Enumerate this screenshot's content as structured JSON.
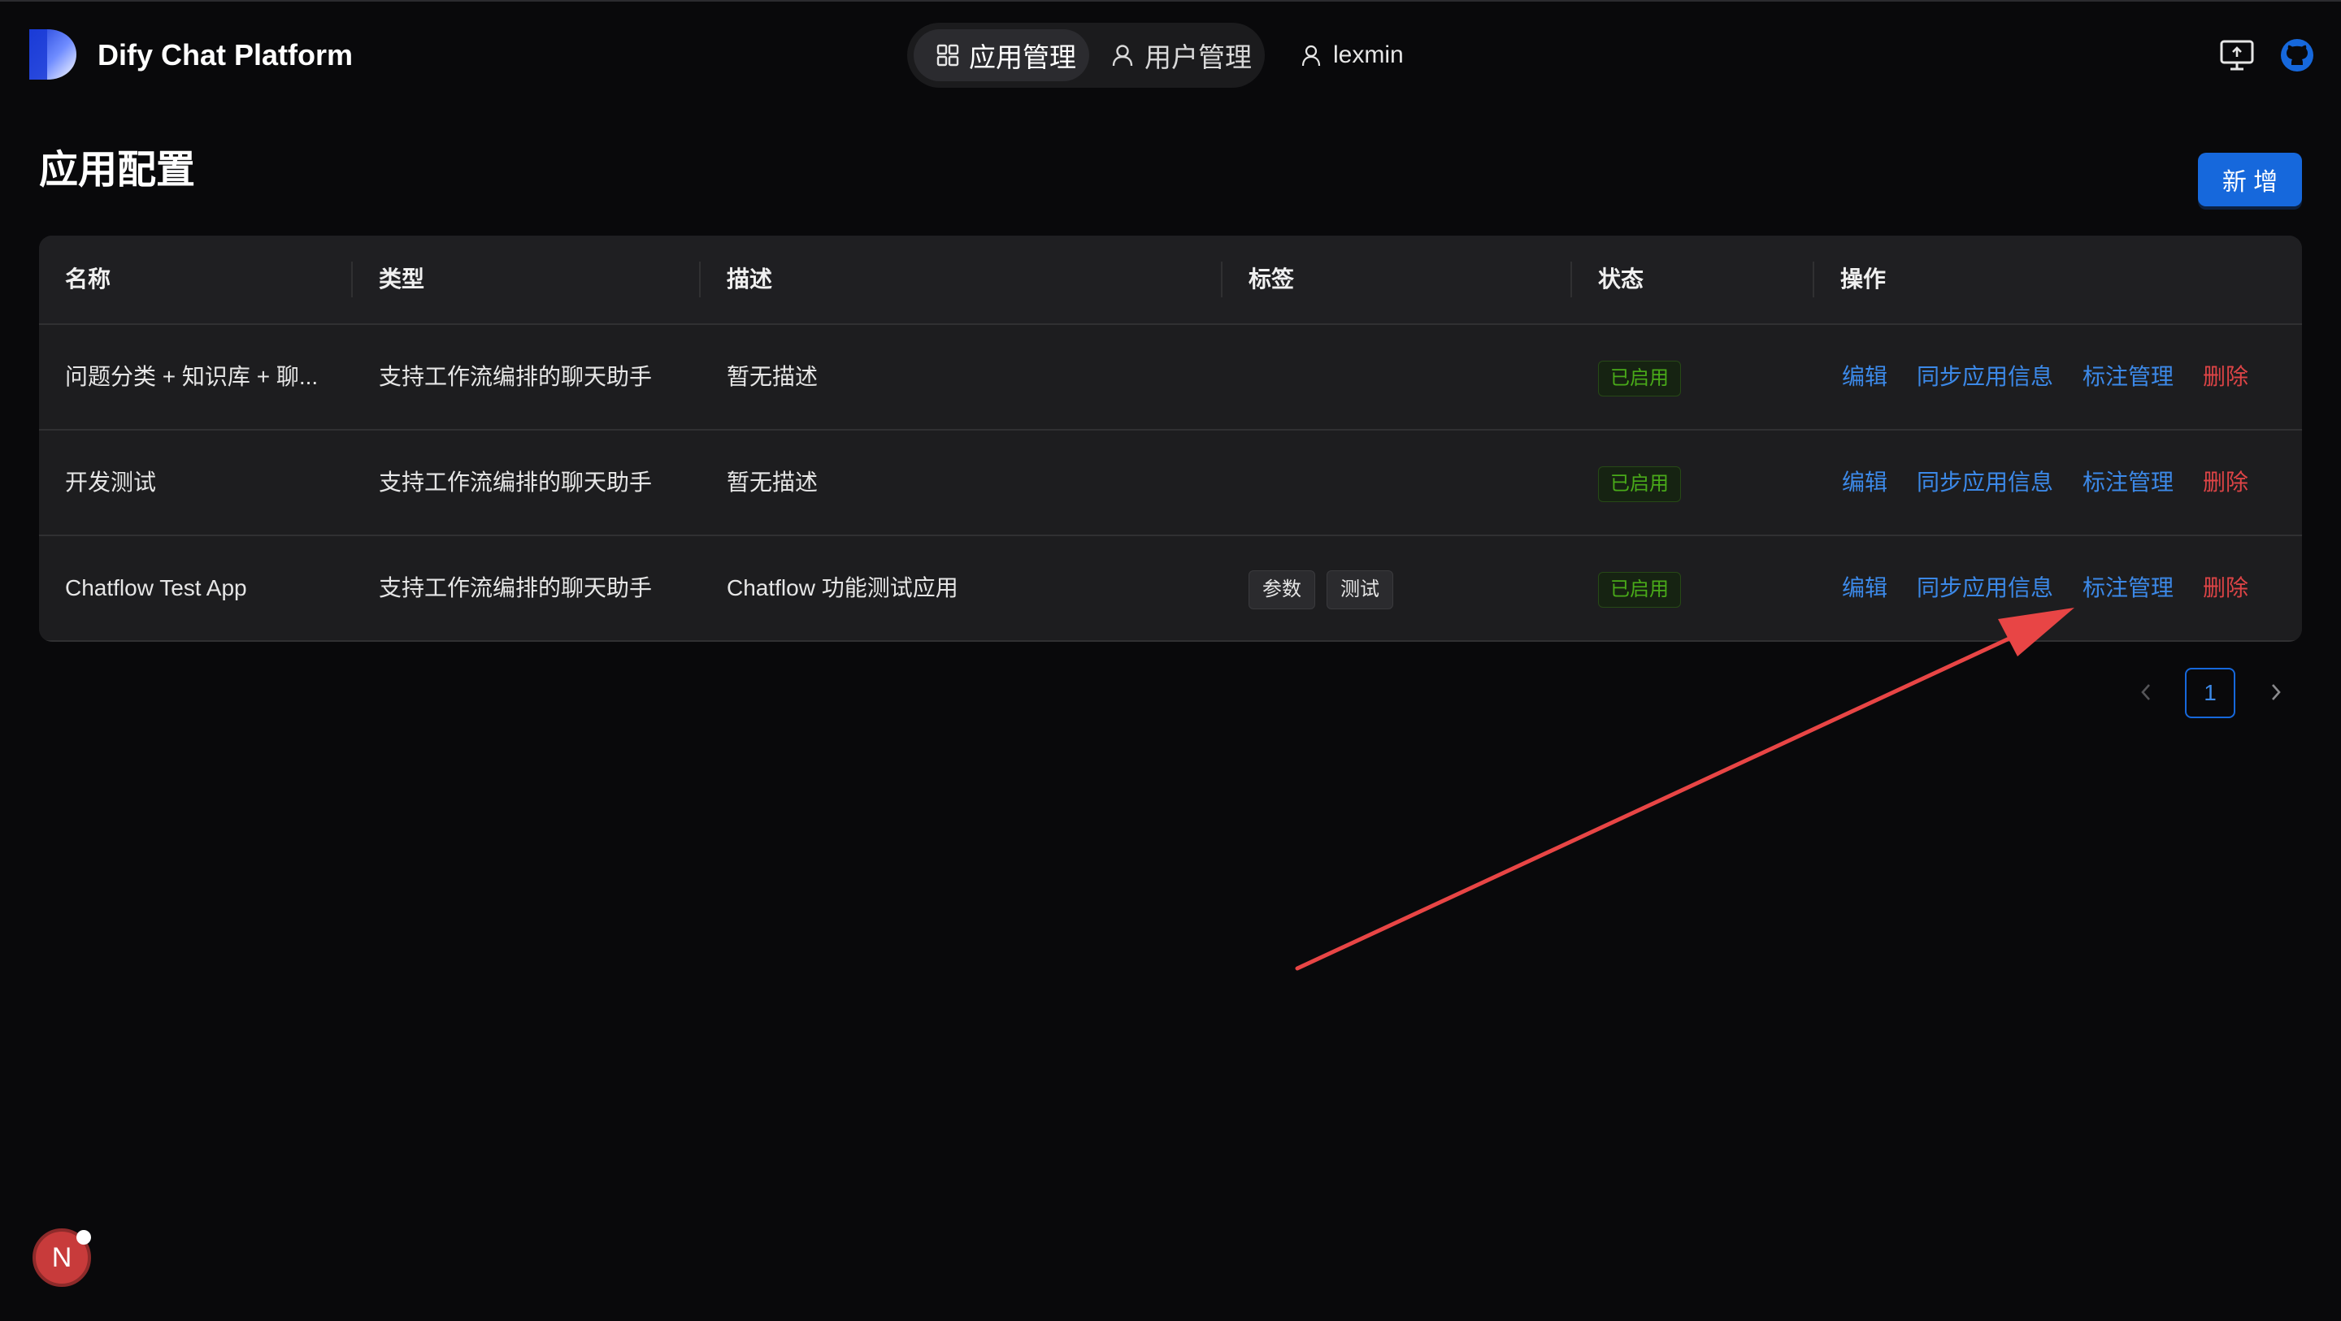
{
  "header": {
    "brand": "Dify Chat Platform",
    "nav": [
      {
        "label": "应用管理",
        "icon": "grid-icon",
        "active": true
      },
      {
        "label": "用户管理",
        "icon": "user-icon",
        "active": false
      }
    ],
    "username": "lexmin",
    "icons": [
      "desktop-icon",
      "github-icon"
    ]
  },
  "page": {
    "title": "应用配置",
    "add_label": "新 增"
  },
  "table": {
    "columns": [
      "名称",
      "类型",
      "描述",
      "标签",
      "状态",
      "操作"
    ],
    "rows": [
      {
        "name": "问题分类 + 知识库 + 聊...",
        "type": "支持工作流编排的聊天助手",
        "desc": "暂无描述",
        "tags": [],
        "status": "已启用"
      },
      {
        "name": "开发测试",
        "type": "支持工作流编排的聊天助手",
        "desc": "暂无描述",
        "tags": [],
        "status": "已启用"
      },
      {
        "name": "Chatflow Test App",
        "type": "支持工作流编排的聊天助手",
        "desc": "Chatflow 功能测试应用",
        "tags": [
          "参数",
          "测试"
        ],
        "status": "已启用"
      }
    ],
    "actions": {
      "edit": "编辑",
      "sync": "同步应用信息",
      "annotate": "标注管理",
      "delete": "删除"
    }
  },
  "pagination": {
    "current": "1"
  },
  "fab": {
    "letter": "N"
  },
  "colors": {
    "accent": "#1668dc",
    "link": "#3c89e8",
    "danger": "#dc4446",
    "success": "#49aa19",
    "annotation_arrow": "#e84545"
  }
}
